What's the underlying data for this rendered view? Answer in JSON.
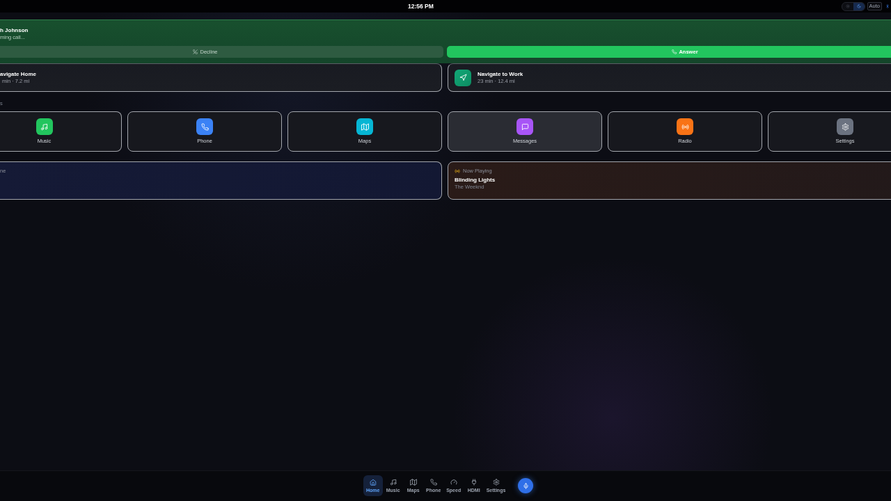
{
  "status_bar": {
    "time": "12:56 PM",
    "theme_modes": [
      {
        "kind": "light",
        "selected": false
      },
      {
        "kind": "dark",
        "selected": true
      }
    ],
    "auto_label": "Auto"
  },
  "incoming_call": {
    "caller": "h Johnson",
    "status": "ming call...",
    "buttons": [
      {
        "kind": "decline",
        "label": "Decline"
      },
      {
        "kind": "answer",
        "label": "Answer"
      }
    ]
  },
  "routes": [
    {
      "title": "avigate Home",
      "detail": "min · 7.2 mi"
    },
    {
      "title": "Navigate to Work",
      "detail": "23 min · 12.4 mi"
    }
  ],
  "section_label": "s",
  "apps": [
    {
      "kind": "music",
      "label": "Music",
      "color": "#22c55e",
      "selected": false
    },
    {
      "kind": "phone",
      "label": "Phone",
      "color": "#3b82f6",
      "selected": false
    },
    {
      "kind": "maps",
      "label": "Maps",
      "color": "#06b6d4",
      "selected": false
    },
    {
      "kind": "messages",
      "label": "Messages",
      "color": "#a855f7",
      "selected": true
    },
    {
      "kind": "radio",
      "label": "Radio",
      "color": "#f97316",
      "selected": false
    },
    {
      "kind": "settings",
      "label": "Settings",
      "color": "#6b7280",
      "selected": false
    }
  ],
  "widgets": [
    {
      "kind": "info",
      "label": "ne"
    },
    {
      "kind": "now_playing",
      "label": "Now Playing",
      "title": "Blinding Lights",
      "artist": "The Weeknd"
    }
  ],
  "dock": {
    "items": [
      {
        "kind": "home",
        "label": "Home",
        "selected": true
      },
      {
        "kind": "music",
        "label": "Music",
        "selected": false
      },
      {
        "kind": "maps",
        "label": "Maps",
        "selected": false
      },
      {
        "kind": "phone",
        "label": "Phone",
        "selected": false
      },
      {
        "kind": "speed",
        "label": "Speed",
        "selected": false
      },
      {
        "kind": "hdmi",
        "label": "HDMI",
        "selected": false
      },
      {
        "kind": "settings",
        "label": "Settings",
        "selected": false
      }
    ]
  }
}
